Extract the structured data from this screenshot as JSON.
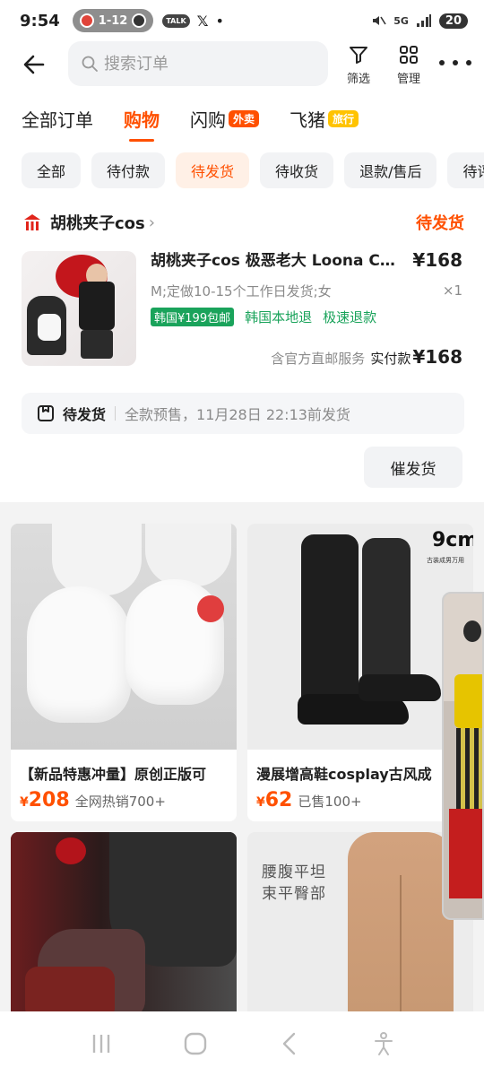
{
  "status_bar": {
    "time": "9:54",
    "pill_text": "1-12",
    "talk_label": "TALK",
    "x_label": "𝕏",
    "dot": "•",
    "network": "5G",
    "battery": "20"
  },
  "header": {
    "search_placeholder": "搜索订单",
    "filter_label": "筛选",
    "manage_label": "管理"
  },
  "category_tabs": [
    {
      "label": "全部订单",
      "badge": ""
    },
    {
      "label": "购物",
      "badge": ""
    },
    {
      "label": "闪购",
      "badge": "外卖"
    },
    {
      "label": "飞猪",
      "badge": "旅行"
    }
  ],
  "filters": [
    "全部",
    "待付款",
    "待发货",
    "待收货",
    "退款/售后",
    "待评价"
  ],
  "order": {
    "shop_name": "胡桃夹子cos",
    "shop_chevron": "›",
    "status": "待发货",
    "product_title": "胡桃夹子cos 极恶老大 Loona Cosplay",
    "price": "¥168",
    "spec": "M;定做10-15个工作日发货;女",
    "qty": "×1",
    "tag_solid": "韩国¥199包邮",
    "tag_1": "韩国本地退",
    "tag_2": "极速退款",
    "service": "含官方直邮服务",
    "paid_label": "实付款",
    "paid_amount": "¥168",
    "ship_label": "待发货",
    "ship_detail": "全款预售，11月28日 22:13前发货",
    "urge_button": "催发货"
  },
  "recommendations": [
    {
      "title": "【新品特惠冲量】原创正版可",
      "price_symbol": "¥",
      "price": "208",
      "sales": "全网热销700+"
    },
    {
      "title": "漫展增高鞋cosplay古风成",
      "price_symbol": "¥",
      "price": "62",
      "sales": "已售100+",
      "img_text_1": "9cm",
      "img_text_2": "古装成男万用"
    },
    {
      "title": "",
      "price_symbol": "",
      "price": "",
      "sales": ""
    },
    {
      "title": "",
      "price_symbol": "",
      "price": "",
      "sales": "",
      "img_text_1": "腰腹平坦",
      "img_text_2": "束平臀部"
    }
  ],
  "colors": {
    "accent": "#ff5000",
    "green": "#1aa35b",
    "chip_bg": "#f2f3f5",
    "chip_active_bg": "#fff0e6",
    "flash_badge": "#ff5000",
    "travel_badge": "#ffc300"
  }
}
